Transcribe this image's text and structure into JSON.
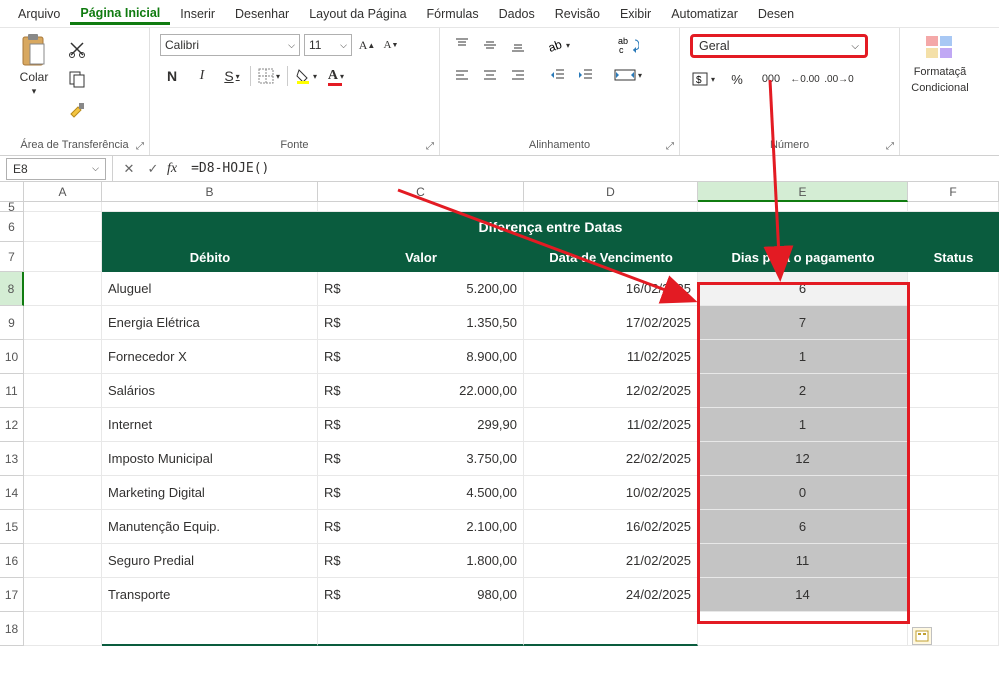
{
  "menu": {
    "tabs": [
      "Arquivo",
      "Página Inicial",
      "Inserir",
      "Desenhar",
      "Layout da Página",
      "Fórmulas",
      "Dados",
      "Revisão",
      "Exibir",
      "Automatizar",
      "Desen"
    ],
    "active_index": 1
  },
  "ribbon": {
    "clipboard": {
      "paste_label": "Colar",
      "group_label": "Área de Transferência"
    },
    "font": {
      "name": "Calibri",
      "size": "11",
      "bold": "N",
      "italic": "I",
      "underline": "S",
      "group_label": "Fonte"
    },
    "alignment": {
      "group_label": "Alinhamento"
    },
    "number": {
      "format": "Geral",
      "group_label": "Número"
    },
    "cond": {
      "label1": "Formataçã",
      "label2": "Condicional"
    }
  },
  "formula_bar": {
    "name_box": "E8",
    "formula": "=D8-HOJE()"
  },
  "columns": [
    "A",
    "B",
    "C",
    "D",
    "E",
    "F"
  ],
  "active_col": "E",
  "row_numbers": [
    "5",
    "6",
    "7",
    "8",
    "9",
    "10",
    "11",
    "12",
    "13",
    "14",
    "15",
    "16",
    "17",
    "18"
  ],
  "active_row": "8",
  "table": {
    "title": "Diferença entre Datas",
    "headers": [
      "Débito",
      "Valor",
      "Data de Vencimento",
      "Dias para o pagamento",
      "Status"
    ],
    "currency": "R$",
    "rows": [
      {
        "debito": "Aluguel",
        "valor": "5.200,00",
        "data": "16/02/2025",
        "dias": "6"
      },
      {
        "debito": "Energia Elétrica",
        "valor": "1.350,50",
        "data": "17/02/2025",
        "dias": "7"
      },
      {
        "debito": "Fornecedor X",
        "valor": "8.900,00",
        "data": "11/02/2025",
        "dias": "1"
      },
      {
        "debito": "Salários",
        "valor": "22.000,00",
        "data": "12/02/2025",
        "dias": "2"
      },
      {
        "debito": "Internet",
        "valor": "299,90",
        "data": "11/02/2025",
        "dias": "1"
      },
      {
        "debito": "Imposto Municipal",
        "valor": "3.750,00",
        "data": "22/02/2025",
        "dias": "12"
      },
      {
        "debito": "Marketing Digital",
        "valor": "4.500,00",
        "data": "10/02/2025",
        "dias": "0"
      },
      {
        "debito": "Manutenção Equip.",
        "valor": "2.100,00",
        "data": "16/02/2025",
        "dias": "6"
      },
      {
        "debito": "Seguro Predial",
        "valor": "1.800,00",
        "data": "21/02/2025",
        "dias": "11"
      },
      {
        "debito": "Transporte",
        "valor": "980,00",
        "data": "24/02/2025",
        "dias": "14"
      }
    ]
  }
}
